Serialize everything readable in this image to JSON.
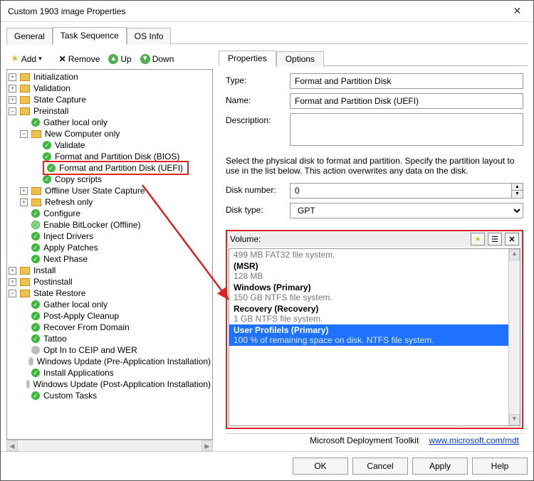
{
  "window": {
    "title": "Custom 1903 image Properties"
  },
  "outerTabs": {
    "general": "General",
    "taskSequence": "Task Sequence",
    "osInfo": "OS Info"
  },
  "toolbar": {
    "add": "Add",
    "remove": "Remove",
    "up": "Up",
    "down": "Down"
  },
  "tree": {
    "initialization": "Initialization",
    "validation": "Validation",
    "stateCapture": "State Capture",
    "preinstall": "Preinstall",
    "gatherLocalOnly": "Gather local only",
    "newComputerOnly": "New Computer only",
    "validate": "Validate",
    "fapdBios": "Format and Partition Disk (BIOS)",
    "fapdUefi": "Format and Partition Disk (UEFI)",
    "copyScripts": "Copy scripts",
    "offlineUserStateCapture": "Offline User State Capture",
    "refreshOnly": "Refresh only",
    "configure": "Configure",
    "enableBitlocker": "Enable BitLocker (Offline)",
    "injectDrivers": "Inject Drivers",
    "applyPatches": "Apply Patches",
    "nextPhase": "Next Phase",
    "install": "Install",
    "postinstall": "Postinstall",
    "stateRestore": "State Restore",
    "gatherLocalOnly2": "Gather local only",
    "postApplyCleanup": "Post-Apply Cleanup",
    "recoverFromDomain": "Recover From Domain",
    "tattoo": "Tattoo",
    "optInCeip": "Opt In to CEIP and WER",
    "windowsUpdatePre": "Windows Update (Pre-Application Installation)",
    "installApplications": "Install Applications",
    "windowsUpdatePost": "Windows Update (Post-Application Installation)",
    "customTasks": "Custom Tasks"
  },
  "innerTabs": {
    "properties": "Properties",
    "options": "Options"
  },
  "form": {
    "typeLabel": "Type:",
    "typeValue": "Format and Partition Disk",
    "nameLabel": "Name:",
    "nameValue": "Format and Partition Disk (UEFI)",
    "descLabel": "Description:",
    "descValue": "",
    "instructions": "Select the physical disk to format and partition.  Specify the partition layout to use in the list below.  This action overwrites any data on the disk.",
    "diskNumberLabel": "Disk number:",
    "diskNumberValue": "0",
    "diskTypeLabel": "Disk type:",
    "diskTypeValue": "GPT"
  },
  "volume": {
    "label": "Volume:",
    "items": [
      {
        "title": "",
        "sub": "499 MB FAT32 file system."
      },
      {
        "title": "  (MSR)",
        "sub": "128 MB"
      },
      {
        "title": "Windows (Primary)",
        "sub": "150 GB NTFS file system."
      },
      {
        "title": "Recovery (Recovery)",
        "sub": "1 GB NTFS file system."
      },
      {
        "title": "User Profilels (Primary)",
        "sub": "100 % of remaining space on disk. NTFS file system."
      }
    ]
  },
  "brand": {
    "name": "Microsoft Deployment Toolkit",
    "url": "www.microsoft.com/mdt"
  },
  "dialog": {
    "ok": "OK",
    "cancel": "Cancel",
    "apply": "Apply",
    "help": "Help"
  }
}
